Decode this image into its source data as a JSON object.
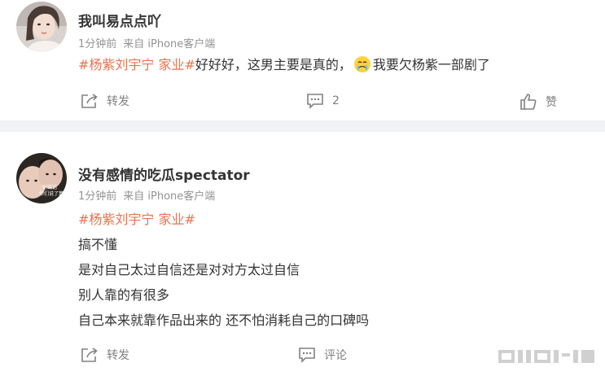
{
  "posts": [
    {
      "username": "我叫易点点吖",
      "time": "1分钟前",
      "source": "来自 iPhone客户端",
      "topic": "#杨紫刘宇宁 家业#",
      "text_before_emoji": "好好好，这男主要是真的，",
      "emoji": "crying-face-emoji",
      "text_after_emoji": "我要欠杨紫一部剧了",
      "share_label": "转发",
      "comment_label": "2",
      "like_label": "赞"
    },
    {
      "username": "没有感情的吃瓜spectator",
      "avatar_text": "别说话\n你们说了算",
      "time": "1分钟前",
      "source": "来自 iPhone客户端",
      "topic": "#杨紫刘宇宁 家业#",
      "lines": [
        "搞不懂",
        "是对自己太过自信还是对对方太过自信",
        "别人靠的有很多",
        "自己本来就靠作品出来的 还不怕消耗自己的口碑吗"
      ],
      "share_label": "转发",
      "comment_label": "评论"
    }
  ],
  "colors": {
    "topic": "#eb7350",
    "meta": "#939393",
    "text": "#333333",
    "separator": "#f1f2f5"
  }
}
